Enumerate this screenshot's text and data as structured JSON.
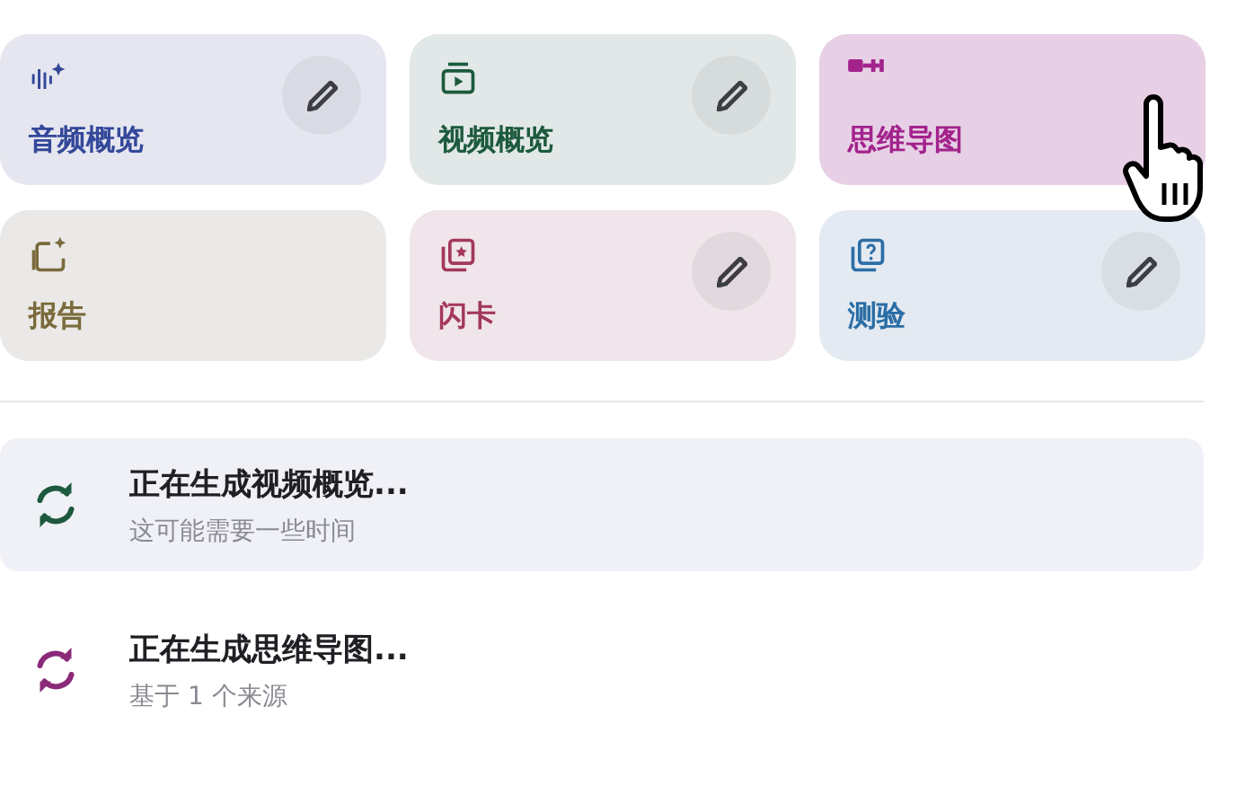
{
  "tiles": [
    {
      "label": "音频概览",
      "kind": "audio",
      "color": "#34489a",
      "hovered": false,
      "edit_button": true
    },
    {
      "label": "视频概览",
      "kind": "video",
      "color": "#1d5a3d",
      "hovered": false,
      "edit_button": true
    },
    {
      "label": "思维导图",
      "kind": "mindmap",
      "color": "#a3238c",
      "hovered": true,
      "edit_button": false
    },
    {
      "label": "报告",
      "kind": "report",
      "color": "#7a6b3c",
      "hovered": false,
      "edit_button": false
    },
    {
      "label": "闪卡",
      "kind": "flashcards",
      "color": "#a3385c",
      "hovered": false,
      "edit_button": true
    },
    {
      "label": "测验",
      "kind": "quiz",
      "color": "#2b6ea6",
      "hovered": false,
      "edit_button": true
    }
  ],
  "generating": [
    {
      "title": "正在生成视频概览...",
      "subtitle": "这可能需要一些时间",
      "color": "#1d5a3d",
      "hovered": true
    },
    {
      "title": "正在生成思维导图...",
      "subtitle": "基于 1 个来源",
      "color": "#8a2a78",
      "hovered": false
    }
  ]
}
